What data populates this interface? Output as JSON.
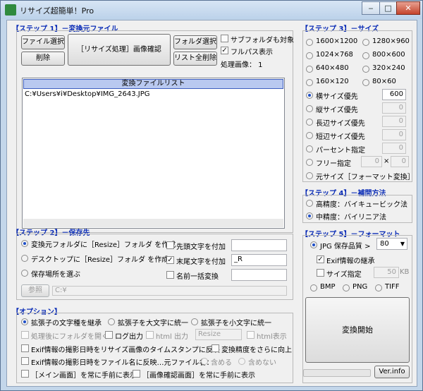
{
  "window": {
    "title": "リサイズ超簡単！Pro",
    "min_glyph": "‒",
    "max_glyph": "□",
    "close_glyph": "✕"
  },
  "step1": {
    "title": "【ステップ 1】－変換元ファイル",
    "file_select": "ファイル選択",
    "delete": "削除",
    "resize_process": "［リサイズ処理］画像確認",
    "folder_select": "フォルダ選択",
    "list_clear_all": "リスト全削除",
    "subfolder_label": "サブフォルダも対象",
    "subfolder_checked": false,
    "fullpath_label": "フルパス表示",
    "fullpath_checked": true,
    "processed_count": "処理画像： 1",
    "list_header": "変換ファイルリスト",
    "files": [
      "C:¥Users¥i¥Desktop¥IMG_2643.JPG"
    ]
  },
  "step2": {
    "title": "【ステップ 2】－保存先",
    "opt_source_folder": "変換元フォルダに［Resize］フォルダ を作成",
    "opt_desktop": "デスクトップに［Resize］フォルダ を作成",
    "opt_choose": "保存場所を選ぶ",
    "selected": 0,
    "prefix_label": "先頭文字を付加",
    "prefix_checked": false,
    "prefix_value": "",
    "suffix_label": "末尾文字を付加",
    "suffix_checked": true,
    "suffix_value": "_R",
    "rename_label": "名前一括変換",
    "rename_checked": false,
    "rename_value": "",
    "browse": "参照",
    "path": "C:¥"
  },
  "step3": {
    "title": "【ステップ 3】－サイズ",
    "sizes": [
      "1600×1200",
      "1280×960",
      "1024×768",
      "800×600",
      "640×480",
      "320×240",
      "160×120",
      "80×60"
    ],
    "width_priority": "横サイズ優先",
    "width_value": "600",
    "height_priority": "縦サイズ優先",
    "height_value": "0",
    "long_priority": "長辺サイズ優先",
    "long_value": "0",
    "short_priority": "短辺サイズ優先",
    "short_value": "0",
    "percent": "パーセント指定",
    "percent_value": "0",
    "free": "フリー指定",
    "free_w": "0",
    "free_h": "0",
    "free_x": "×",
    "original": "元サイズ［フォーマット変換］",
    "selected": "width_priority"
  },
  "step4": {
    "title": "【ステップ 4】－補間方法",
    "high": "高精度：バイキュービック法",
    "medium": "中精度：バイリニア法",
    "selected": "medium"
  },
  "step5": {
    "title": "【ステップ 5】－フォーマット",
    "jpg_label": "JPG 保存品質 >",
    "quality": "80",
    "exif_keep": "Exif情報の継承",
    "exif_checked": true,
    "size_spec": "サイズ指定",
    "size_checked": false,
    "size_value": "50",
    "size_unit": "KB",
    "bmp": "BMP",
    "png": "PNG",
    "tiff": "TIFF",
    "selected": "jpg",
    "start": "変換開始",
    "version": "Ver.info"
  },
  "options": {
    "title": "【オプション】",
    "keep_ext_case": "拡張子の文字種を継承",
    "ext_upper": "拡張子を大文字に統一",
    "ext_lower": "拡張子を小文字に統一",
    "open_folder": "処理後にフォルダを開く",
    "log_output": "ログ出力",
    "html_output": "html 出力",
    "html_value": "Resize",
    "html_view": "html表示",
    "exif_timestamp": "Exif情報の撮影日時をリサイズ画像のタイムスタンプに反映",
    "precision_up": "変換精度をさらに向上",
    "exif_filename": "Exif情報の撮影日時をファイル名に反映…元ファイル名：",
    "include": "含める",
    "exclude": "含めない",
    "main_topmost": "［メイン画面］を常に手前に表示",
    "confirm_topmost": "［画像確認画面］を常に手前に表示"
  }
}
